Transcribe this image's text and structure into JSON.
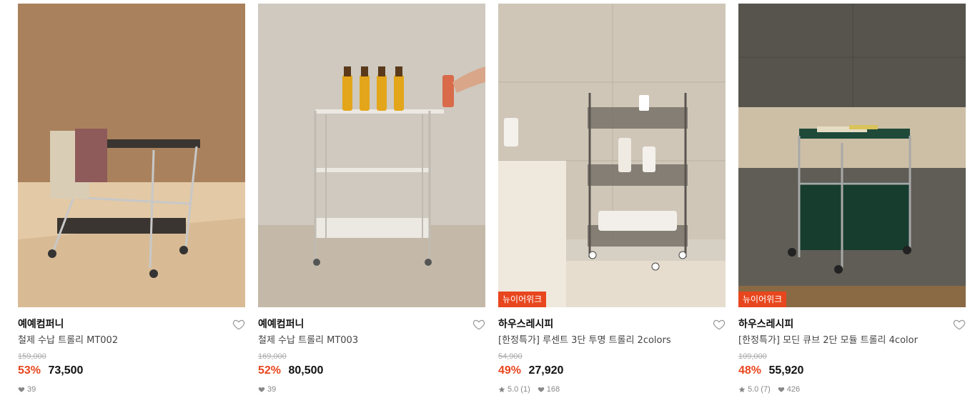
{
  "products": [
    {
      "brand": "예예컴퍼니",
      "name": "철제 수납 트롤리 MT002",
      "original_price": "159,000",
      "discount": "53%",
      "price": "73,500",
      "rating": "",
      "review_count": "",
      "likes": "39",
      "badge": ""
    },
    {
      "brand": "예예컴퍼니",
      "name": "철제 수납 트롤리 MT003",
      "original_price": "169,000",
      "discount": "52%",
      "price": "80,500",
      "rating": "",
      "review_count": "",
      "likes": "39",
      "badge": ""
    },
    {
      "brand": "하우스레시피",
      "name": "[한정특가] 루센트 3단 투명 트롤리 2colors",
      "original_price": "54,900",
      "discount": "49%",
      "price": "27,920",
      "rating": "5.0",
      "review_count": "(1)",
      "likes": "168",
      "badge": "뉴이어위크"
    },
    {
      "brand": "하우스레시피",
      "name": "[한정특가] 모딘 큐브 2단 모듈 트롤리 4color",
      "original_price": "109,000",
      "discount": "48%",
      "price": "55,920",
      "rating": "5.0",
      "review_count": "(7)",
      "likes": "426",
      "badge": "뉴이어위크"
    }
  ],
  "colors": {
    "accent": "#e8461e",
    "muted": "#888888",
    "strike": "#aaaaaa"
  },
  "icons": {
    "wishlist": "heart-outline-icon",
    "likes": "heart-filled-icon",
    "rating": "star-icon"
  }
}
